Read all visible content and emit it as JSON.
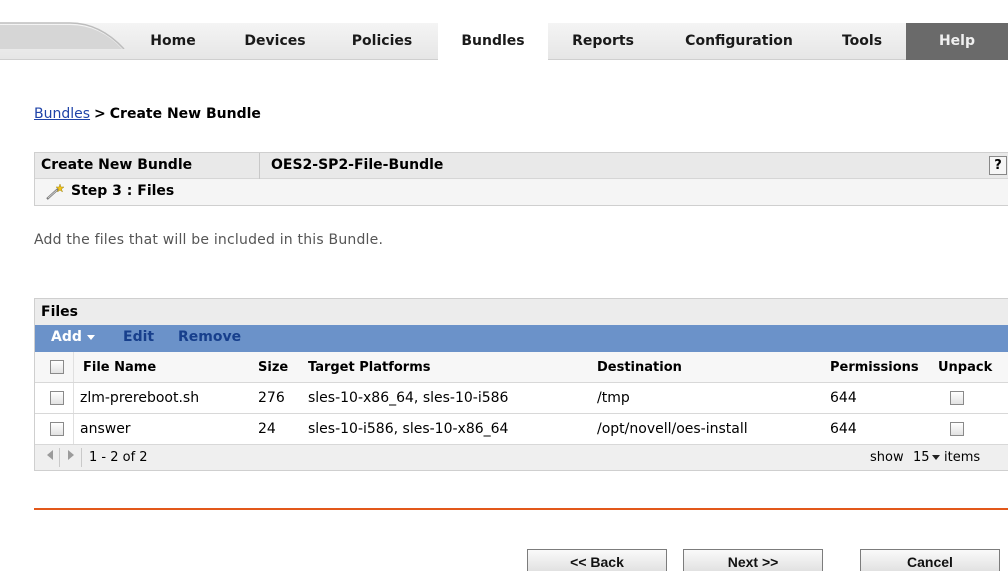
{
  "nav": {
    "items": [
      {
        "label": "Home"
      },
      {
        "label": "Devices"
      },
      {
        "label": "Policies"
      },
      {
        "label": "Bundles"
      },
      {
        "label": "Reports"
      },
      {
        "label": "Configuration"
      },
      {
        "label": "Tools"
      },
      {
        "label": "Help"
      }
    ],
    "active": "Bundles"
  },
  "breadcrumb": {
    "link": "Bundles",
    "separator": ">",
    "current": "Create New Bundle"
  },
  "header": {
    "title": "Create New Bundle",
    "bundle_name": "OES2-SP2-File-Bundle",
    "help_label": "?",
    "step_label": "Step 3 : Files"
  },
  "intro_text": "Add the files that will be included in this Bundle.",
  "files": {
    "panel_title": "Files",
    "toolbar": {
      "add": "Add",
      "edit": "Edit",
      "remove": "Remove"
    },
    "columns": {
      "file_name": "File Name",
      "size": "Size",
      "target_platforms": "Target Platforms",
      "destination": "Destination",
      "permissions": "Permissions",
      "unpack": "Unpack"
    },
    "rows": [
      {
        "file_name": "zlm-prereboot.sh",
        "size": "276",
        "target_platforms": "sles-10-x86_64, sles-10-i586",
        "destination": "/tmp",
        "permissions": "644"
      },
      {
        "file_name": "answer",
        "size": "24",
        "target_platforms": "sles-10-i586, sles-10-x86_64",
        "destination": "/opt/novell/oes-install",
        "permissions": "644"
      }
    ],
    "pager": {
      "range": "1 - 2 of 2",
      "show_label": "show",
      "page_size": "15",
      "items_label": "items"
    }
  },
  "buttons": {
    "back": "<< Back",
    "next": "Next >>",
    "cancel": "Cancel"
  },
  "colors": {
    "toolbar": "#6b92c9",
    "accent_line": "#e2581a",
    "link": "#1f43a8",
    "help_tab": "#6a6a6a"
  },
  "icons": {
    "step": "wand-icon",
    "prev": "triangle-left-icon",
    "next": "triangle-right-icon"
  }
}
